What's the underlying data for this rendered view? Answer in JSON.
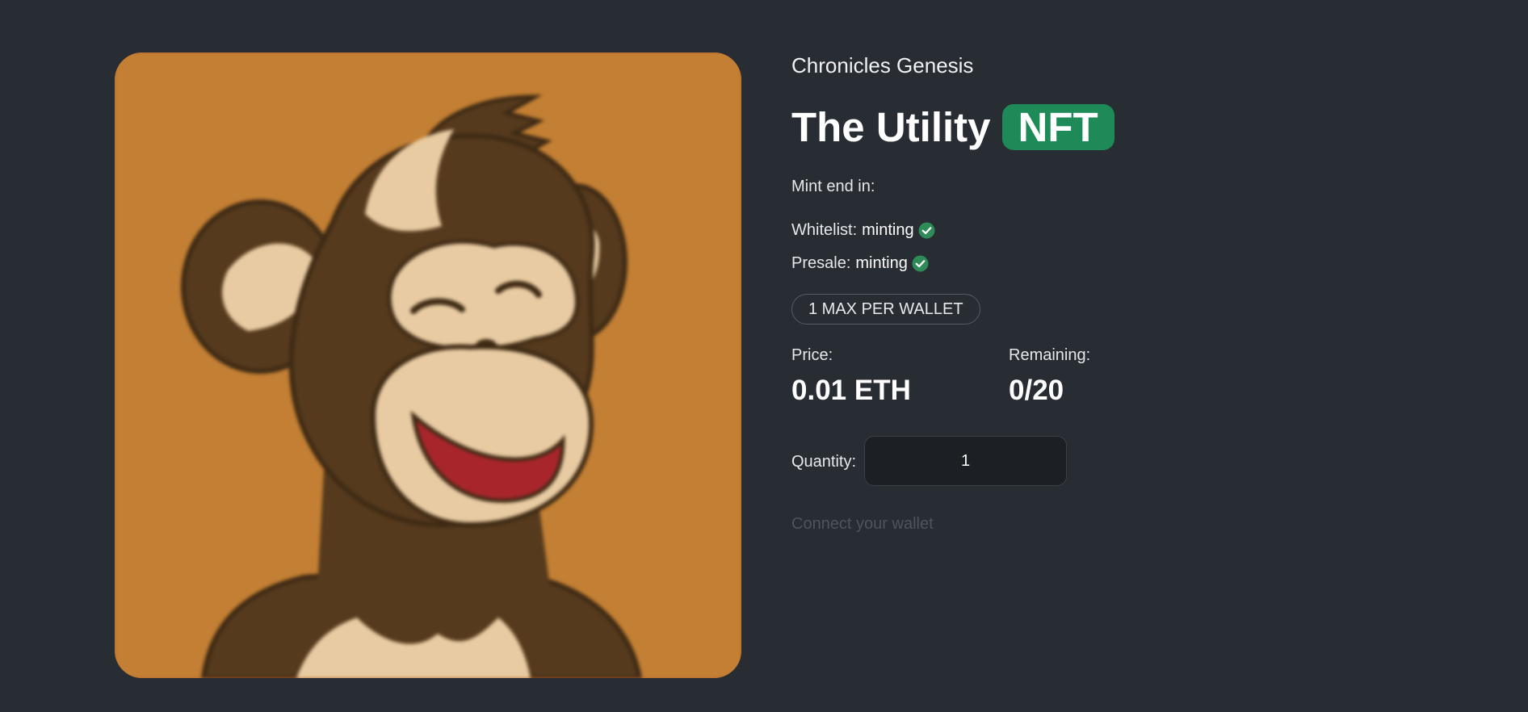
{
  "collection_name": "Chronicles Genesis",
  "title": {
    "main": "The Utility",
    "badge": "NFT"
  },
  "mint_end_label": "Mint end in:",
  "phases": [
    {
      "label": "Whitelist:",
      "status": "minting",
      "icon": "check-circle-icon"
    },
    {
      "label": "Presale:",
      "status": "minting",
      "icon": "check-circle-icon"
    }
  ],
  "limit_badge": "1 MAX PER WALLET",
  "price": {
    "label": "Price:",
    "value": "0.01 ETH"
  },
  "remaining": {
    "label": "Remaining:",
    "value": "0/20"
  },
  "quantity": {
    "label": "Quantity:",
    "value": "1"
  },
  "connect_text": "Connect your wallet",
  "artwork": {
    "subject": "cartoon monkey",
    "background_color": "#c37f33"
  },
  "colors": {
    "page_background": "#282c33",
    "badge_green": "#1e8a57",
    "check_green": "#2e8b57"
  }
}
